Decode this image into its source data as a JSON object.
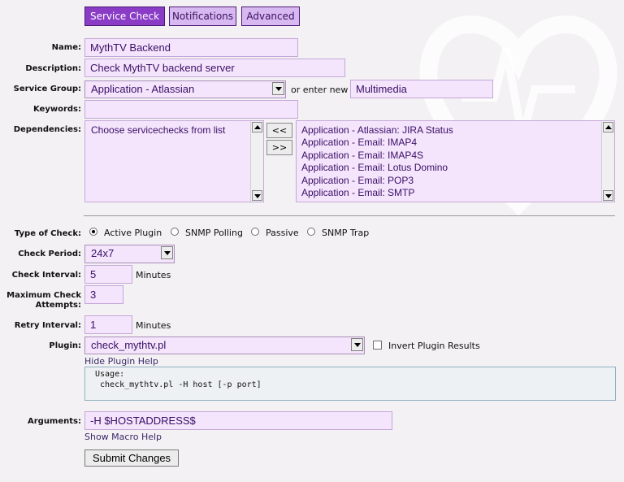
{
  "tabs": [
    {
      "label": "Service Check",
      "active": true
    },
    {
      "label": "Notifications",
      "active": false
    },
    {
      "label": "Advanced",
      "active": false
    }
  ],
  "form": {
    "name_label": "Name:",
    "name_value": "MythTV Backend",
    "description_label": "Description:",
    "description_value": "Check MythTV backend server",
    "service_group_label": "Service Group:",
    "service_group_selected": "Application - Atlassian",
    "or_enter_new_label": "or enter new",
    "new_group_value": "Multimedia",
    "keywords_label": "Keywords:",
    "keywords_value": "",
    "dependencies_label": "Dependencies:",
    "dependencies_selected": [
      "Choose servicechecks from list"
    ],
    "move_left_label": "<<",
    "move_right_label": ">>",
    "dependencies_available": [
      "Application - Atlassian: JIRA Status",
      "Application - Email: IMAP4",
      "Application - Email: IMAP4S",
      "Application - Email: Lotus Domino",
      "Application - Email: POP3",
      "Application - Email: SMTP"
    ],
    "type_of_check_label": "Type of Check:",
    "check_types": [
      {
        "label": "Active Plugin",
        "checked": true
      },
      {
        "label": "SNMP Polling",
        "checked": false
      },
      {
        "label": "Passive",
        "checked": false
      },
      {
        "label": "SNMP Trap",
        "checked": false
      }
    ],
    "check_period_label": "Check Period:",
    "check_period_value": "24x7",
    "check_interval_label": "Check Interval:",
    "check_interval_value": "5",
    "minutes_label": "Minutes",
    "max_attempts_label_1": "Maximum Check",
    "max_attempts_label_2": "Attempts:",
    "max_attempts_value": "3",
    "retry_interval_label": "Retry Interval:",
    "retry_interval_value": "1",
    "plugin_label": "Plugin:",
    "plugin_value": "check_mythtv.pl",
    "invert_label": "Invert Plugin Results",
    "invert_checked": false,
    "hide_plugin_help": "Hide Plugin Help",
    "plugin_help_lines": [
      "Usage:",
      " check_mythtv.pl -H host [-p port]"
    ],
    "arguments_label": "Arguments:",
    "arguments_value": "-H $HOSTADDRESS$",
    "show_macro_help": "Show Macro Help",
    "submit_label": "Submit Changes"
  },
  "colors": {
    "tab_active_bg": "#8a3cc7",
    "tab_bg": "#d8b8f0",
    "field_bg": "#f4e4fc",
    "text_purple": "#3a0f66"
  }
}
